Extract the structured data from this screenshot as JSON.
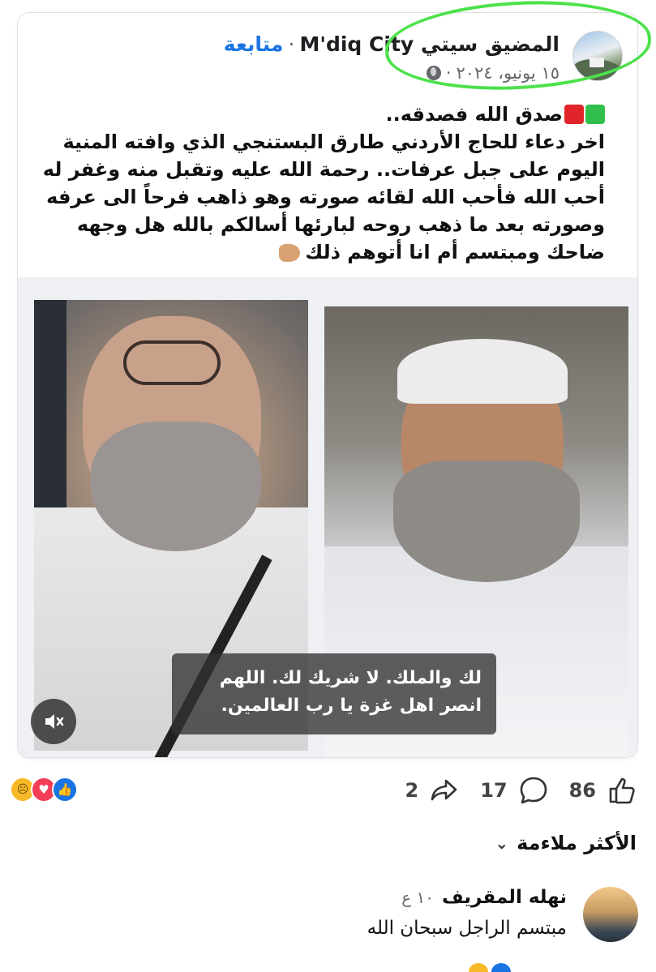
{
  "post": {
    "author_name": "المضيق سيتي M'diq City",
    "separator": "·",
    "follow_label": "متابعة",
    "date": "١٥ يونيو، ٢٠٢٤",
    "dot": "·",
    "text_lines": [
      "صدق الله فصدقه..",
      "اخر دعاء للحاج الأردني طارق البستنجي الذي وافته المنية",
      "اليوم على جبل عرفات.. رحمة الله عليه وتقبل منه وغفر له",
      "أحب الله فأحب الله لقائه صورته وهو ذاهب فرحاً الى عرفه",
      "وصورته بعد ما ذهب روحه لبارئها أسالكم بالله هل وجهه",
      "ضاحك ومبتسم أم انا أتوهم ذلك"
    ]
  },
  "video": {
    "caption_line1": "لك والملك. لا شريك لك. اللهم",
    "caption_line2": "انصر اهل غزة يا رب العالمين."
  },
  "engagement": {
    "likes": "86",
    "comments": "17",
    "shares": "2",
    "reaction_icons": [
      "like-icon",
      "love-icon",
      "sad-icon"
    ]
  },
  "comments_section": {
    "sort_label": "الأكثر ملاءمة",
    "comments": [
      {
        "author": "نهله المقريف",
        "time": "١٠ ع",
        "text": "مبتسم الراجل سبحان الله"
      }
    ]
  },
  "colors": {
    "accent": "#1b74e4",
    "highlight": "#4ce14a",
    "secondary_text": "#65676b"
  }
}
